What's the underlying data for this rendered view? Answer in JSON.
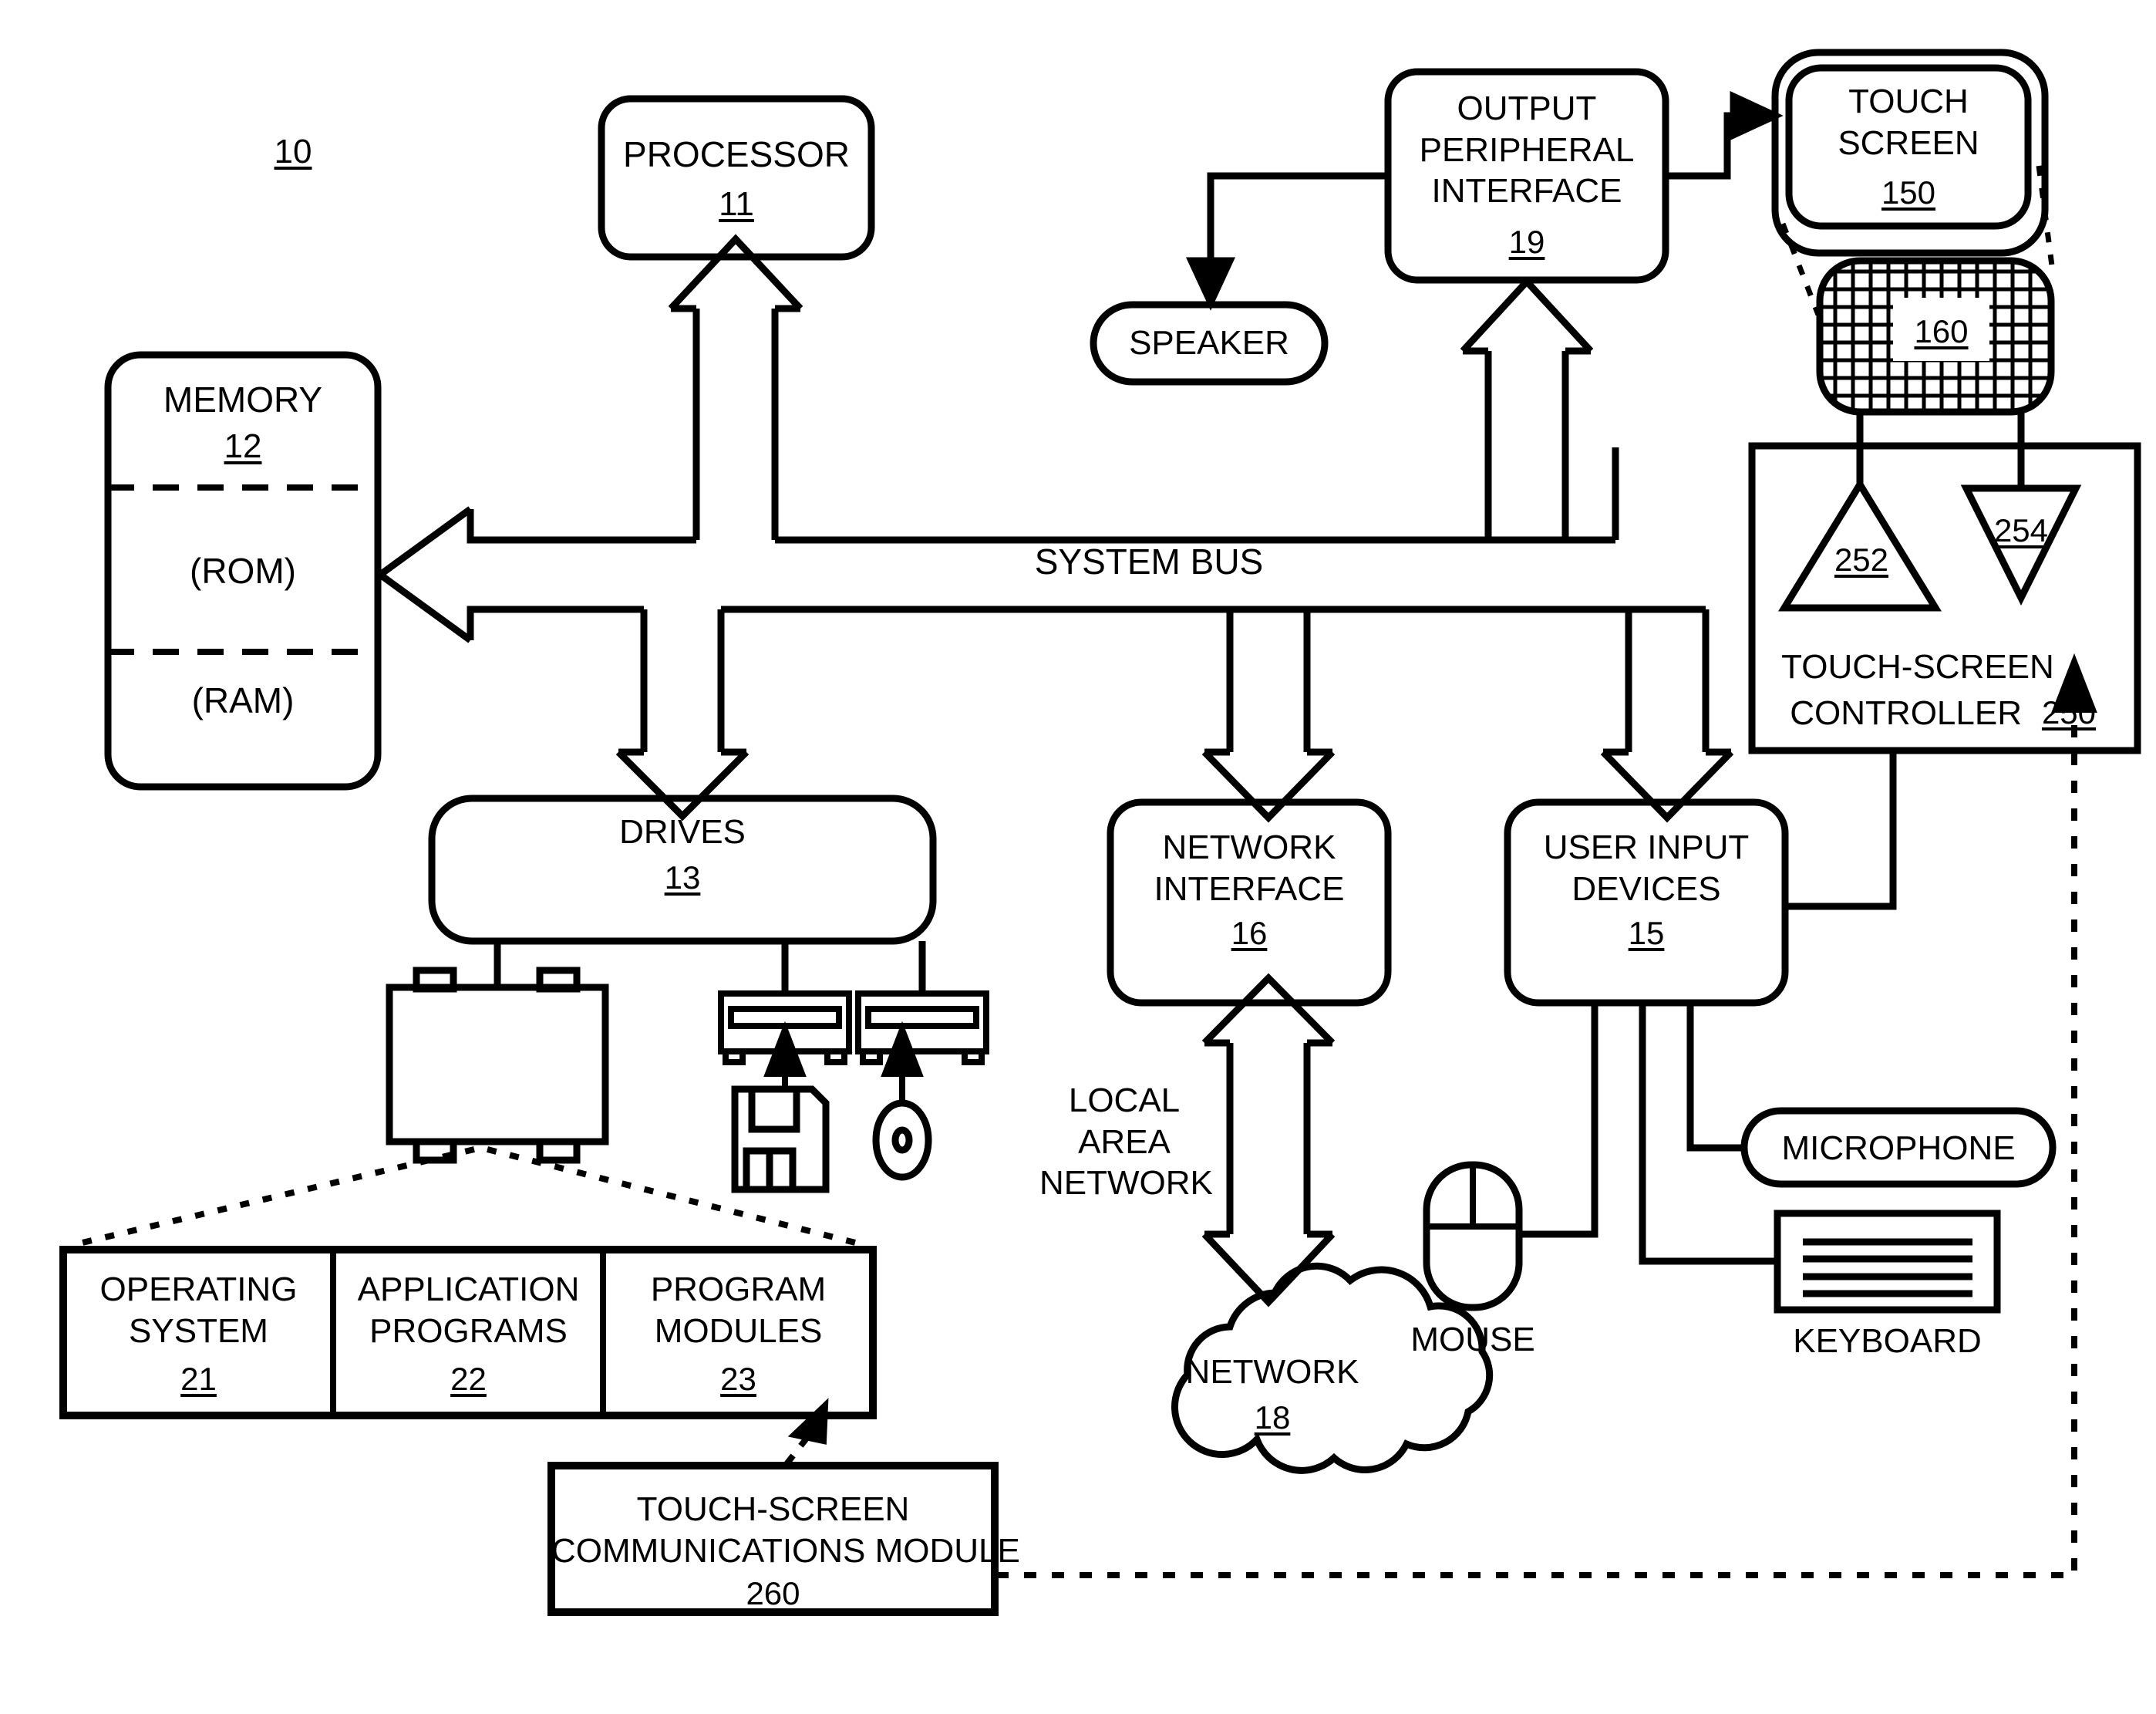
{
  "figure": {
    "figure_number": "10",
    "bus_label": "SYSTEM BUS",
    "lan_label": "LOCAL\nAREA\nNETWORK"
  },
  "blocks": {
    "processor": {
      "title": "PROCESSOR",
      "ref": "11"
    },
    "memory": {
      "title": "MEMORY",
      "ref": "12",
      "rom": "(ROM)",
      "ram": "(RAM)"
    },
    "drives": {
      "title": "DRIVES",
      "ref": "13"
    },
    "network_iface": {
      "title": "NETWORK\nINTERFACE",
      "ref": "16"
    },
    "user_input": {
      "title": "USER INPUT\nDEVICES",
      "ref": "15"
    },
    "output_iface": {
      "title": "OUTPUT\nPERIPHERAL\nINTERFACE",
      "ref": "19"
    },
    "speaker": {
      "title": "SPEAKER",
      "ref": ""
    },
    "touch_screen": {
      "title": "TOUCH\nSCREEN",
      "ref": "150"
    },
    "touch_grid": {
      "title": "",
      "ref": "160"
    },
    "ts_controller": {
      "title": "TOUCH-SCREEN",
      "title2": "CONTROLLER",
      "ref": "250"
    },
    "driver_252": {
      "ref": "252"
    },
    "receiver_254": {
      "ref": "254"
    },
    "network_cloud": {
      "title": "NETWORK",
      "ref": "18"
    },
    "microphone": {
      "title": "MICROPHONE",
      "ref": ""
    },
    "keyboard": {
      "title": "KEYBOARD",
      "ref": ""
    },
    "mouse": {
      "title": "MOUSE",
      "ref": ""
    },
    "ts_comm_module": {
      "title": "TOUCH-SCREEN",
      "title2": "COMMUNICATIONS MODULE",
      "ref": "260"
    }
  },
  "memory_table": {
    "cells": [
      {
        "title": "OPERATING\nSYSTEM",
        "ref": "21"
      },
      {
        "title": "APPLICATION\nPROGRAMS",
        "ref": "22"
      },
      {
        "title": "PROGRAM\nMODULES",
        "ref": "23"
      }
    ]
  },
  "colors": {
    "stroke": "#000000",
    "fill": "#ffffff"
  }
}
